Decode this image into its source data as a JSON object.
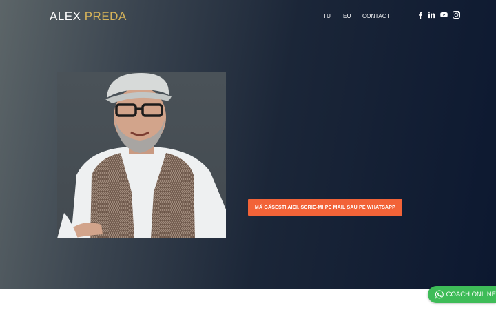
{
  "header": {
    "logo_first": "ALEX",
    "logo_second": "PREDA",
    "nav": [
      {
        "label": "TU"
      },
      {
        "label": "EU"
      },
      {
        "label": "CONTACT"
      }
    ],
    "social_icons": [
      "facebook-icon",
      "linkedin-icon",
      "youtube-icon",
      "instagram-icon"
    ]
  },
  "hero": {
    "cta_label": "MĂ GĂSEȘTI AICI. SCRIE-MI PE MAIL SAU PE WHATSAPP"
  },
  "whatsapp": {
    "label": "COACH ONLINE"
  },
  "colors": {
    "accent_logo": "#d9b55a",
    "cta": "#f26338",
    "whatsapp": "#3ebc58",
    "hero_dark": "#0c1830"
  }
}
